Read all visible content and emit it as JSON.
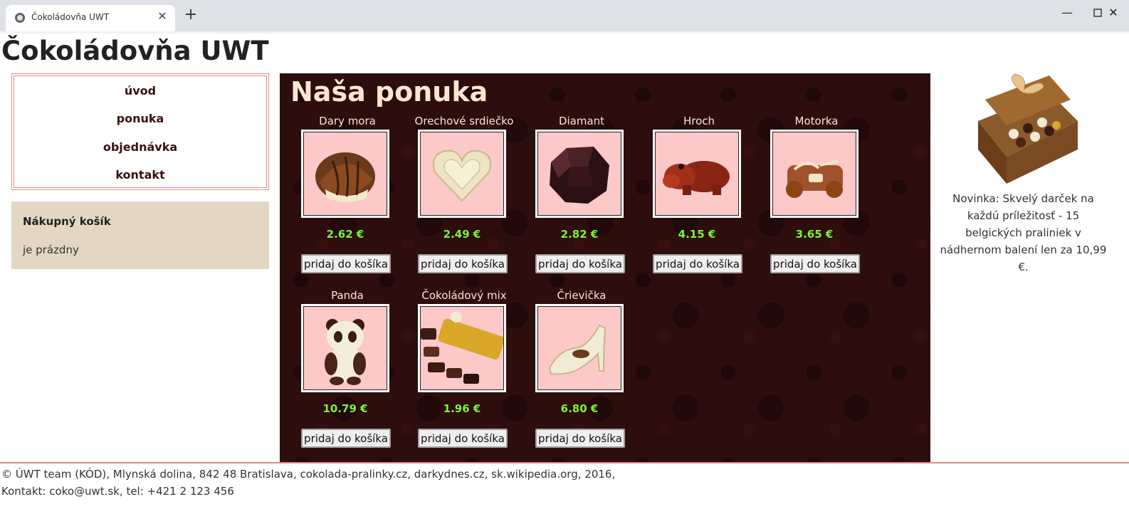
{
  "browser": {
    "tab_title": "Čokoládovňa UWT",
    "new_tab_label": "+",
    "close_label": "✕",
    "minimize_label": "—",
    "maximize_label": "☐",
    "window_close_label": "✕"
  },
  "site": {
    "title": "Čokoládovňa UWT"
  },
  "nav": {
    "items": [
      {
        "label": "úvod"
      },
      {
        "label": "ponuka"
      },
      {
        "label": "objednávka"
      },
      {
        "label": "kontakt"
      }
    ]
  },
  "cart": {
    "heading": "Nákupný košík",
    "status": "je prázdny"
  },
  "offer": {
    "heading": "Naša ponuka",
    "add_label": "pridaj do košíka",
    "products": [
      {
        "name": "Dary mora",
        "price": "2.62 €",
        "icon": "shell-praline-icon"
      },
      {
        "name": "Orechové srdiečko",
        "price": "2.49 €",
        "icon": "heart-praline-icon"
      },
      {
        "name": "Diamant",
        "price": "2.82 €",
        "icon": "diamond-praline-icon"
      },
      {
        "name": "Hroch",
        "price": "4.15 €",
        "icon": "hippo-chocolate-icon"
      },
      {
        "name": "Motorka",
        "price": "3.65 €",
        "icon": "motorbike-chocolate-icon"
      },
      {
        "name": "Panda",
        "price": "10.79 €",
        "icon": "panda-chocolate-icon"
      },
      {
        "name": "Čokoládový mix",
        "price": "1.96 €",
        "icon": "chocolate-mix-icon"
      },
      {
        "name": "Črievička",
        "price": "6.80 €",
        "icon": "shoe-chocolate-icon"
      }
    ]
  },
  "aside": {
    "image": "chocolate-gift-box-icon",
    "text": "Novinka: Skvelý darček na každú príležitosť - 15 belgických praliniek v nádhernom balení len za 10,99 €."
  },
  "footer": {
    "line1": "© ÚWT team (KÓD), Mlynská dolina, 842 48 Bratislava, cokolada-pralinky.cz, darkydnes.cz, sk.wikipedia.org, 2016,",
    "line2": "Kontakt: coko@uwt.sk, tel: +421 2 123 456"
  },
  "colors": {
    "offer_bg": "#2e0d0d",
    "heading_text": "#fbe7d0",
    "price_green": "#7cf23a",
    "product_bg": "#fcc8c8",
    "cart_bg": "#e3d7c3",
    "nav_border": "#e8888c"
  }
}
